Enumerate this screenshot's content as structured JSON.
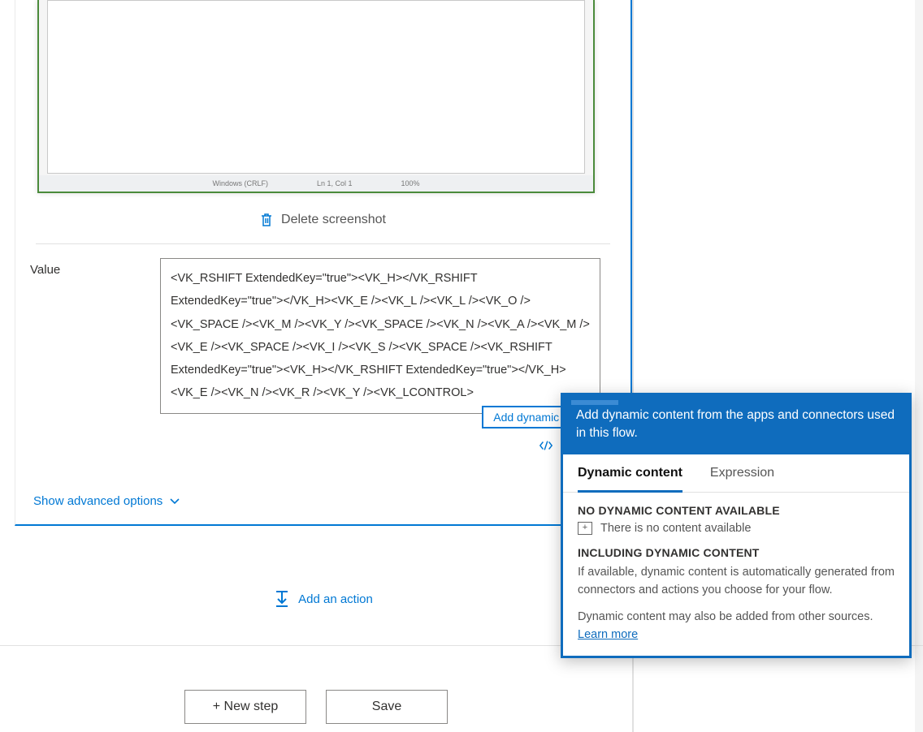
{
  "card": {
    "screenshot_footer": {
      "a": "Windows (CRLF)",
      "b": "Ln 1, Col 1",
      "c": "100%"
    },
    "delete_label": "Delete screenshot",
    "value_label": "Value",
    "value_text": "<VK_RSHIFT ExtendedKey=\"true\"><VK_H></VK_RSHIFT ExtendedKey=\"true\"></VK_H><VK_E /><VK_L /><VK_L /><VK_O /><VK_SPACE /><VK_M /><VK_Y /><VK_SPACE /><VK_N /><VK_A /><VK_M /><VK_E /><VK_SPACE /><VK_I /><VK_S /><VK_SPACE /><VK_RSHIFT ExtendedKey=\"true\"><VK_H></VK_RSHIFT ExtendedKey=\"true\"></VK_H><VK_E /><VK_N /><VK_R /><VK_Y /><VK_LCONTROL>",
    "add_dynamic": "Add dynamic content",
    "edit_code": "Edit code",
    "show_advanced": "Show advanced options"
  },
  "add_action": "Add an action",
  "footer": {
    "new_step": "+  New step",
    "save": "Save"
  },
  "dyn": {
    "header": "Add dynamic content from the apps and connectors used in this flow.",
    "tab_dynamic": "Dynamic content",
    "tab_expression": "Expression",
    "none_title": "NO DYNAMIC CONTENT AVAILABLE",
    "none_msg": "There is no content available",
    "inc_title": "INCLUDING DYNAMIC CONTENT",
    "inc_p1": "If available, dynamic content is automatically generated from connectors and actions you choose for your flow.",
    "inc_p2": "Dynamic content may also be added from other sources.",
    "learn": "Learn more"
  }
}
